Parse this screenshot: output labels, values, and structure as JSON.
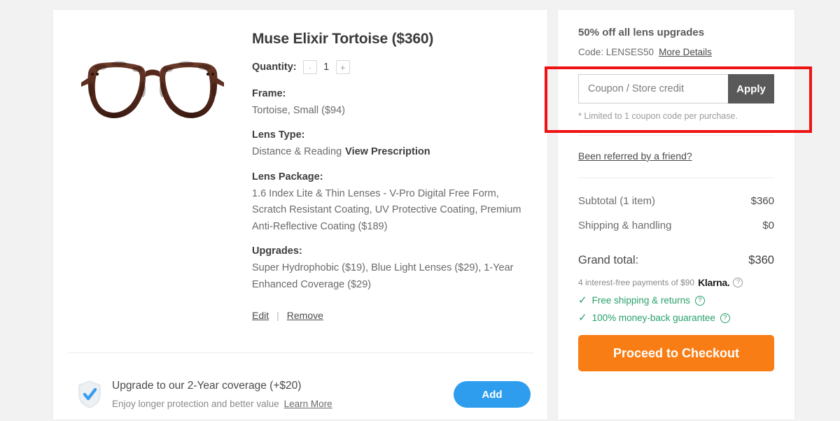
{
  "product": {
    "image_alt": "tortoise-eyeglasses",
    "title": "Muse Elixir Tortoise  ($360)",
    "quantity": {
      "label": "Quantity:",
      "decrement": "-",
      "value": "1",
      "increment": "+"
    },
    "specs": [
      {
        "label": "Frame:",
        "value": "Tortoise, Small  ($94)",
        "link": ""
      },
      {
        "label": "Lens Type:",
        "value": "Distance & Reading",
        "link": "View Prescription"
      },
      {
        "label": "Lens Package:",
        "value": "1.6 Index Lite & Thin Lenses - V-Pro Digital Free Form, Scratch Resistant Coating, UV Protective Coating, Premium Anti-Reflective Coating  ($189)",
        "link": ""
      },
      {
        "label": "Upgrades:",
        "value": "Super Hydrophobic ($19), Blue Light Lenses ($29), 1-Year Enhanced Coverage ($29)",
        "link": ""
      }
    ],
    "actions": {
      "edit": "Edit",
      "separator": "|",
      "remove": "Remove"
    }
  },
  "upgrade_banner": {
    "icon": "shield-check-icon",
    "title": "Upgrade to our 2-Year coverage  (+$20)",
    "subtitle": "Enjoy longer protection and better value",
    "learn_more": "Learn More",
    "add_button": "Add"
  },
  "summary": {
    "promo": {
      "title": "50% off all lens upgrades",
      "code_line": "Code: LENSES50",
      "more_details": "More Details"
    },
    "coupon": {
      "placeholder": "Coupon / Store credit",
      "value": "",
      "apply_label": "Apply",
      "note": "* Limited to 1 coupon code per purchase."
    },
    "referral_link": "Been referred by a friend?",
    "totals": [
      {
        "label": "Subtotal (1 item)",
        "amount": "$360"
      },
      {
        "label": "Shipping & handling",
        "amount": "$0"
      }
    ],
    "grand_total": {
      "label": "Grand total:",
      "amount": "$360"
    },
    "klarna": {
      "text": "4 interest-free payments of $90",
      "logo": "Klarna.",
      "help": "?"
    },
    "benefits": [
      {
        "check": "✓",
        "label": "Free shipping & returns",
        "help": "?"
      },
      {
        "check": "✓",
        "label": "100% money-back guarantee",
        "help": "?"
      }
    ],
    "checkout_button": "Proceed to Checkout"
  },
  "colors": {
    "accent_orange": "#f97d15",
    "accent_blue": "#2e9ded",
    "apply_gray": "#595959",
    "benefit_green": "#28a06a",
    "highlight_red": "#ef1212",
    "page_background": "#f2f2f2"
  }
}
